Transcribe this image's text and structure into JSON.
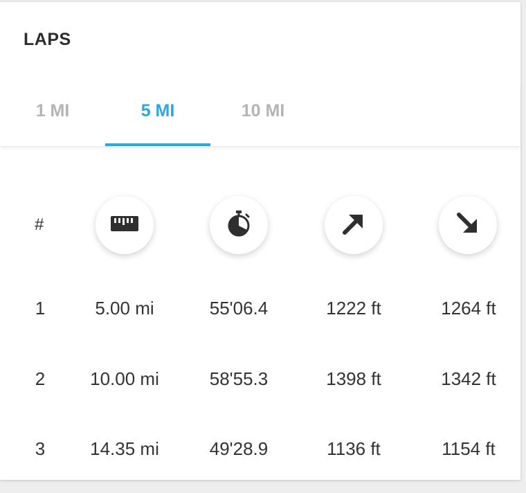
{
  "header": {
    "title": "LAPS"
  },
  "tabs": [
    {
      "label": "1 MI",
      "selected": false
    },
    {
      "label": "5 MI",
      "selected": true
    },
    {
      "label": "10 MI",
      "selected": false
    }
  ],
  "accent_color": "#2ea6e0",
  "table": {
    "index_header": "#",
    "column_icons": [
      "ruler-icon",
      "stopwatch-icon",
      "arrow-up-right-icon",
      "arrow-down-right-icon"
    ],
    "rows": [
      {
        "index": "1",
        "distance": "5.00 mi",
        "time": "55'06.4",
        "ascent": "1222 ft",
        "descent": "1264 ft"
      },
      {
        "index": "2",
        "distance": "10.00 mi",
        "time": "58'55.3",
        "ascent": "1398 ft",
        "descent": "1342 ft"
      },
      {
        "index": "3",
        "distance": "14.35 mi",
        "time": "49'28.9",
        "ascent": "1136 ft",
        "descent": "1154 ft"
      }
    ]
  }
}
